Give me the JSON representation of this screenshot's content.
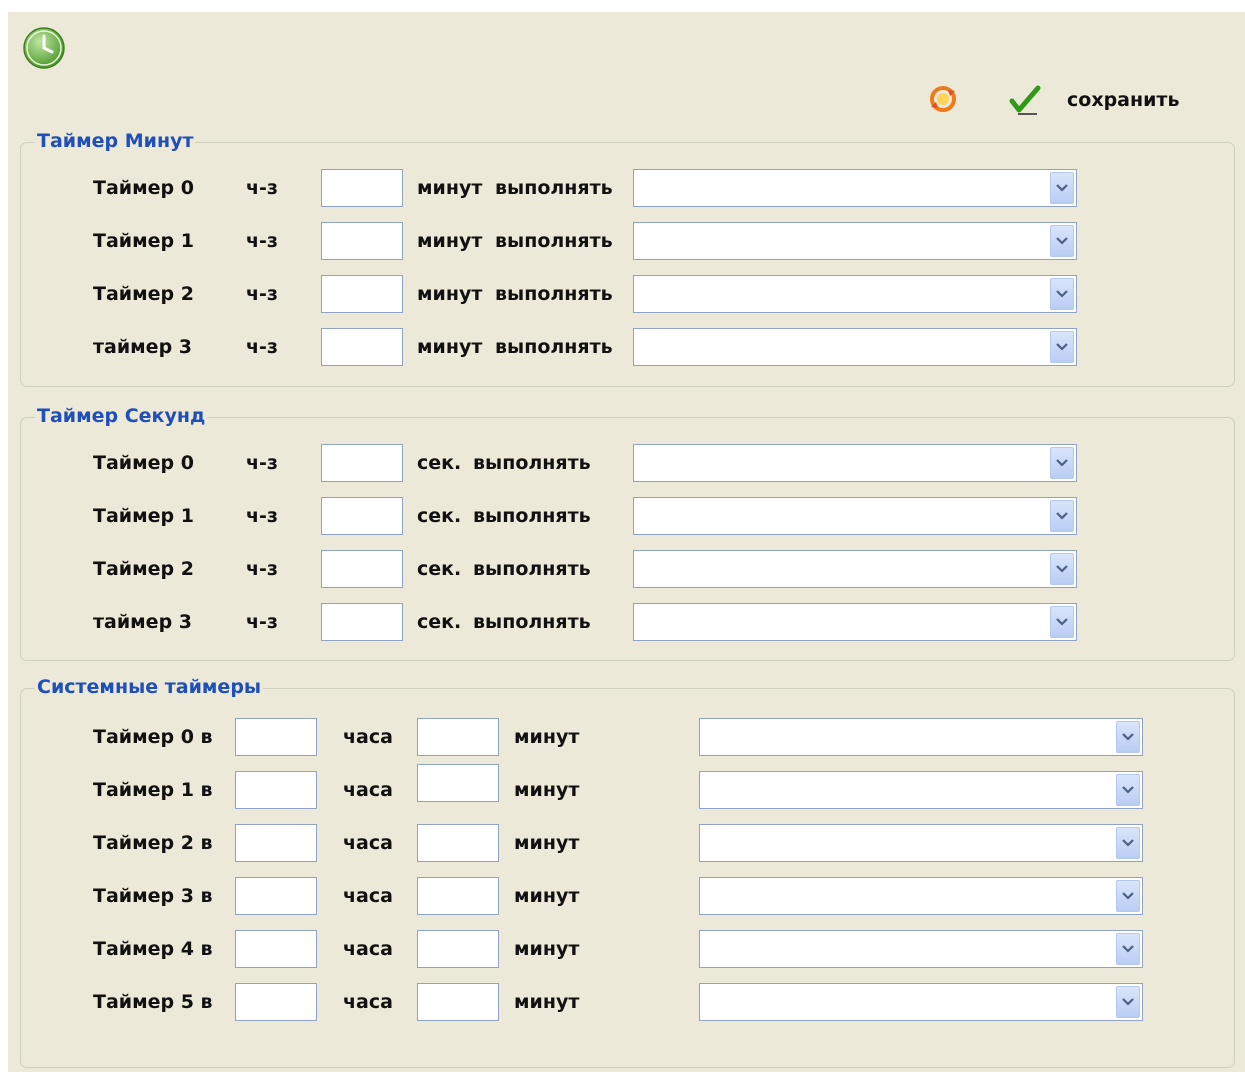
{
  "toolbar": {
    "app_icon": "clock-icon",
    "refresh_icon": "refresh-icon",
    "save_icon": "checkmark-icon",
    "save_label": "сохранить"
  },
  "colors": {
    "background": "#ece9d8",
    "group_title": "#1f4fb8",
    "field_border": "#8ea3c6"
  },
  "minute_timers": {
    "title": "Таймер Минут",
    "rows": [
      {
        "label": "Таймер 0",
        "via": "ч-з",
        "value": "",
        "unit": "минут",
        "action_label": "выполнять",
        "action": ""
      },
      {
        "label": "Таймер 1",
        "via": "ч-з",
        "value": "",
        "unit": "минут",
        "action_label": "выполнять",
        "action": ""
      },
      {
        "label": "Таймер 2",
        "via": "ч-з",
        "value": "",
        "unit": "минут",
        "action_label": "выполнять",
        "action": ""
      },
      {
        "label": "таймер 3",
        "via": "ч-з",
        "value": "",
        "unit": "минут",
        "action_label": "выполнять",
        "action": ""
      }
    ]
  },
  "second_timers": {
    "title": "Таймер Секунд",
    "rows": [
      {
        "label": "Таймер 0",
        "via": "ч-з",
        "value": "",
        "unit": "сек.",
        "action_label": "выполнять",
        "action": ""
      },
      {
        "label": "Таймер 1",
        "via": "ч-з",
        "value": "",
        "unit": "сек.",
        "action_label": "выполнять",
        "action": ""
      },
      {
        "label": "Таймер 2",
        "via": "ч-з",
        "value": "",
        "unit": "сек.",
        "action_label": "выполнять",
        "action": ""
      },
      {
        "label": "таймер 3",
        "via": "ч-з",
        "value": "",
        "unit": "сек.",
        "action_label": "выполнять",
        "action": ""
      }
    ]
  },
  "system_timers": {
    "title": "Системные таймеры",
    "rows": [
      {
        "label": "Таймер 0 в",
        "hours": "",
        "hours_label": "часа",
        "minutes": "",
        "minutes_label": "минут",
        "action": ""
      },
      {
        "label": "Таймер 1 в",
        "hours": "",
        "hours_label": "часа",
        "minutes": "",
        "minutes_label": "минут",
        "action": ""
      },
      {
        "label": "Таймер 2 в",
        "hours": "",
        "hours_label": "часа",
        "minutes": "",
        "minutes_label": "минут",
        "action": ""
      },
      {
        "label": "Таймер 3 в",
        "hours": "",
        "hours_label": "часа",
        "minutes": "",
        "minutes_label": "минут",
        "action": ""
      },
      {
        "label": "Таймер 4 в",
        "hours": "",
        "hours_label": "часа",
        "minutes": "",
        "minutes_label": "минут",
        "action": ""
      },
      {
        "label": "Таймер 5 в",
        "hours": "",
        "hours_label": "часа",
        "minutes": "",
        "minutes_label": "минут",
        "action": ""
      }
    ]
  }
}
